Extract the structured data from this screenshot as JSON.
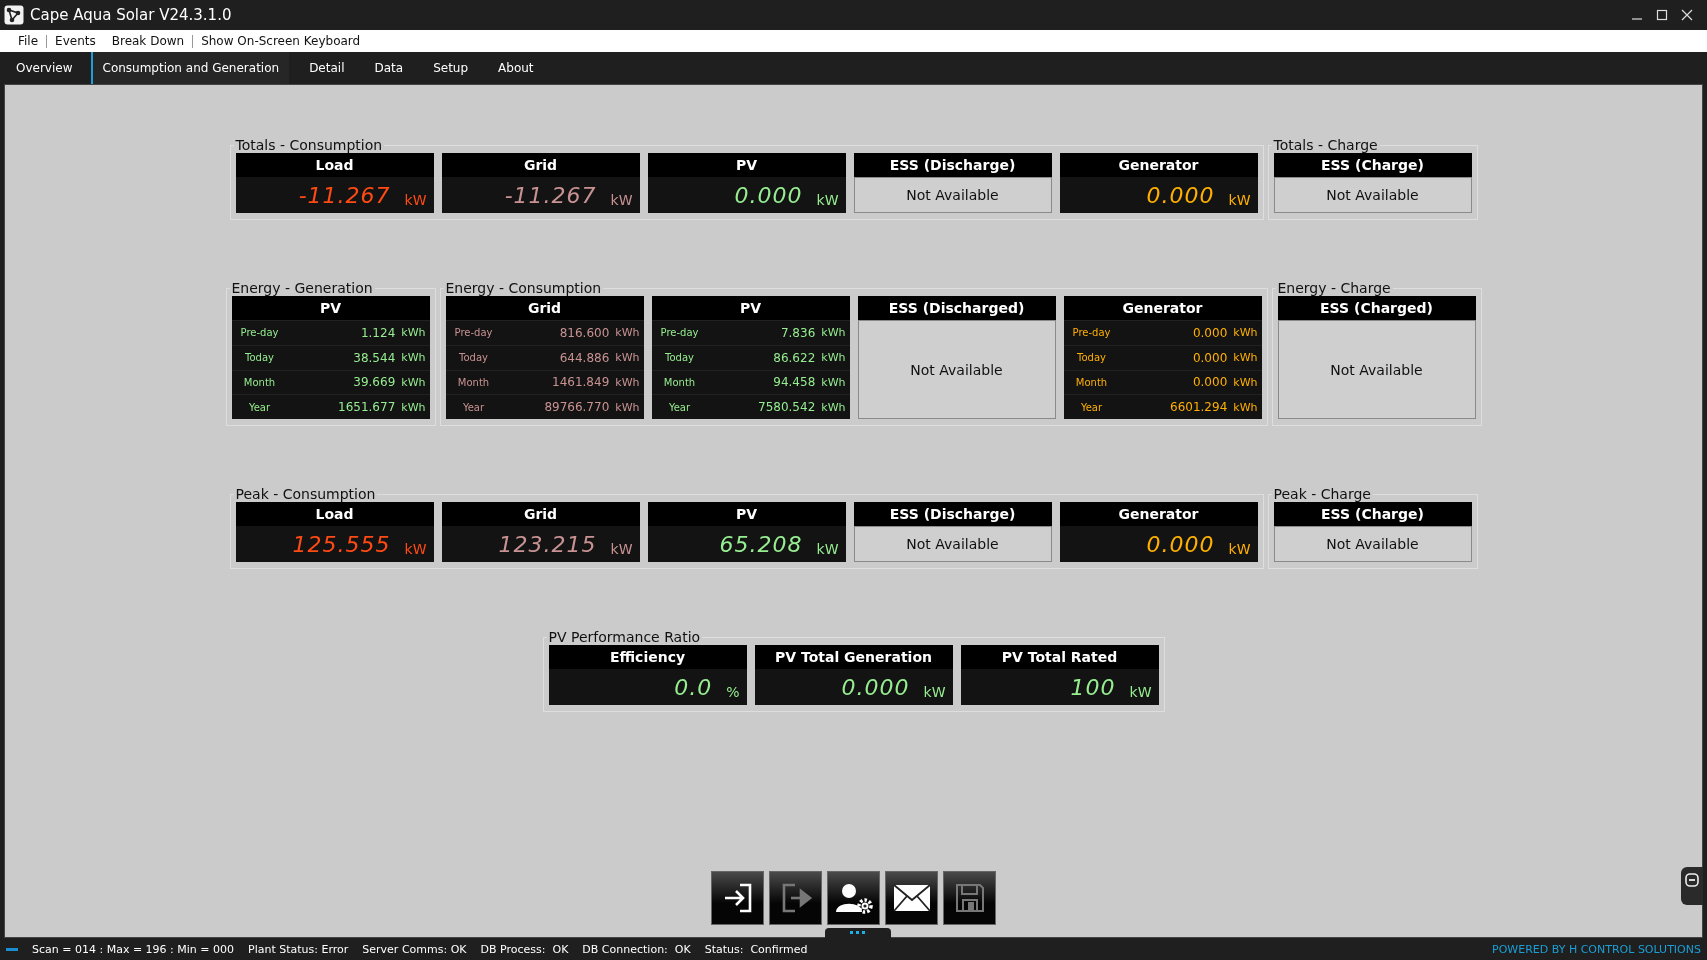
{
  "window": {
    "title": "Cape Aqua Solar V24.3.1.0"
  },
  "menu": [
    {
      "label": "File",
      "separator_after": true
    },
    {
      "label": "Events",
      "separator_after": false
    },
    {
      "label": "Break Down",
      "separator_after": true
    },
    {
      "label": "Show On-Screen Keyboard",
      "separator_after": false
    }
  ],
  "tabs": [
    {
      "label": "Overview",
      "selected": false
    },
    {
      "label": "Consumption and Generation",
      "selected": true
    },
    {
      "label": "Detail",
      "selected": false
    },
    {
      "label": "Data",
      "selected": false
    },
    {
      "label": "Setup",
      "selected": false
    },
    {
      "label": "About",
      "selected": false
    }
  ],
  "rows": [
    {
      "groups": [
        {
          "title": "Totals - Consumption",
          "cards": [
            {
              "kind": "reading",
              "title": "Load",
              "value": "-11.267",
              "unit": "kW",
              "color": "#ff4a14"
            },
            {
              "kind": "reading",
              "title": "Grid",
              "value": "-11.267",
              "unit": "kW",
              "color": "#c89292"
            },
            {
              "kind": "reading",
              "title": "PV",
              "value": "0.000",
              "unit": "kW",
              "color": "#96ee90"
            },
            {
              "kind": "unavailable",
              "title": "ESS (Discharge)",
              "text": "Not Available"
            },
            {
              "kind": "reading",
              "title": "Generator",
              "value": "0.000",
              "unit": "kW",
              "color": "#ffb000"
            }
          ]
        },
        {
          "title": "Totals - Charge",
          "cards": [
            {
              "kind": "unavailable",
              "title": "ESS (Charge)",
              "text": "Not Available"
            }
          ]
        }
      ]
    },
    {
      "groups": [
        {
          "title": "Energy - Generation",
          "cards": [
            {
              "kind": "energy",
              "title": "PV",
              "color": "#96ee90",
              "rows": [
                {
                  "label": "Pre-day",
                  "value": "1.124",
                  "unit": "kWh"
                },
                {
                  "label": "Today",
                  "value": "38.544",
                  "unit": "kWh"
                },
                {
                  "label": "Month",
                  "value": "39.669",
                  "unit": "kWh"
                },
                {
                  "label": "Year",
                  "value": "1651.677",
                  "unit": "kWh"
                }
              ]
            }
          ]
        },
        {
          "title": "Energy - Consumption",
          "cards": [
            {
              "kind": "energy",
              "title": "Grid",
              "color": "#c89292",
              "rows": [
                {
                  "label": "Pre-day",
                  "value": "816.600",
                  "unit": "kWh"
                },
                {
                  "label": "Today",
                  "value": "644.886",
                  "unit": "kWh"
                },
                {
                  "label": "Month",
                  "value": "1461.849",
                  "unit": "kWh"
                },
                {
                  "label": "Year",
                  "value": "89766.770",
                  "unit": "kWh"
                }
              ]
            },
            {
              "kind": "energy",
              "title": "PV",
              "color": "#96ee90",
              "rows": [
                {
                  "label": "Pre-day",
                  "value": "7.836",
                  "unit": "kWh"
                },
                {
                  "label": "Today",
                  "value": "86.622",
                  "unit": "kWh"
                },
                {
                  "label": "Month",
                  "value": "94.458",
                  "unit": "kWh"
                },
                {
                  "label": "Year",
                  "value": "7580.542",
                  "unit": "kWh"
                }
              ]
            },
            {
              "kind": "unavailable",
              "title": "ESS (Discharged)",
              "text": "Not Available"
            },
            {
              "kind": "energy",
              "title": "Generator",
              "color": "#ffb000",
              "rows": [
                {
                  "label": "Pre-day",
                  "value": "0.000",
                  "unit": "kWh"
                },
                {
                  "label": "Today",
                  "value": "0.000",
                  "unit": "kWh"
                },
                {
                  "label": "Month",
                  "value": "0.000",
                  "unit": "kWh"
                },
                {
                  "label": "Year",
                  "value": "6601.294",
                  "unit": "kWh"
                }
              ]
            }
          ]
        },
        {
          "title": "Energy - Charge",
          "cards": [
            {
              "kind": "unavailable",
              "title": "ESS (Charged)",
              "text": "Not Available"
            }
          ]
        }
      ]
    },
    {
      "groups": [
        {
          "title": "Peak - Consumption",
          "cards": [
            {
              "kind": "reading",
              "title": "Load",
              "value": "125.555",
              "unit": "kW",
              "color": "#ff4a14"
            },
            {
              "kind": "reading",
              "title": "Grid",
              "value": "123.215",
              "unit": "kW",
              "color": "#c89292"
            },
            {
              "kind": "reading",
              "title": "PV",
              "value": "65.208",
              "unit": "kW",
              "color": "#96ee90"
            },
            {
              "kind": "unavailable",
              "title": "ESS (Discharge)",
              "text": "Not Available"
            },
            {
              "kind": "reading",
              "title": "Generator",
              "value": "0.000",
              "unit": "kW",
              "color": "#ffb000"
            }
          ]
        },
        {
          "title": "Peak - Charge",
          "cards": [
            {
              "kind": "unavailable",
              "title": "ESS (Charge)",
              "text": "Not Available"
            }
          ]
        }
      ]
    },
    {
      "groups": [
        {
          "title": "PV Performance Ratio",
          "cards": [
            {
              "kind": "reading",
              "title": "Efficiency",
              "value": "0.0",
              "unit": "%",
              "color": "#96ee90"
            },
            {
              "kind": "reading",
              "title": "PV Total Generation",
              "value": "0.000",
              "unit": "kW",
              "color": "#96ee90"
            },
            {
              "kind": "reading",
              "title": "PV Total Rated",
              "value": "100",
              "unit": "kW",
              "color": "#96ee90"
            }
          ]
        }
      ]
    }
  ],
  "toolbar": [
    {
      "kind": "enter",
      "disabled": false
    },
    {
      "kind": "exit",
      "disabled": true
    },
    {
      "kind": "user-settings",
      "disabled": false
    },
    {
      "kind": "mail",
      "disabled": false
    },
    {
      "kind": "save",
      "disabled": true
    }
  ],
  "status_bar": {
    "items": [
      "Scan = 014 : Max = 196 : Min = 000",
      "Plant Status: Error",
      "Server Comms: OK",
      "DB Process:  OK",
      "DB Connection:  OK",
      "Status:  Confirmed"
    ],
    "brand": "POWERED BY H CONTROL SOLUTIONS"
  }
}
